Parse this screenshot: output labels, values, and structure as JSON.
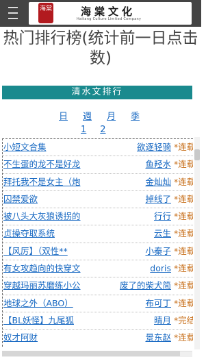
{
  "header": {
    "menu_icon": "hamburger-icon",
    "logo_seal_text": "海棠",
    "logo_name": "海棠文化",
    "logo_sub": "Haitang Culture Limited Company"
  },
  "page_title": "热门排行榜(统计前一日点击数)",
  "section_title": "清水文排行",
  "periods": [
    "日",
    "週",
    "月",
    "季"
  ],
  "pages": [
    "1",
    "2"
  ],
  "colors": {
    "section_bg": "#1a8a8e",
    "link": "#1768c2",
    "status": "#c8711d"
  },
  "rankings": [
    {
      "title": "小短文合集",
      "author": "欲逐轻骑",
      "status": "*连载"
    },
    {
      "title": "不生蛋的龙不是好龙",
      "author": "鱼羟水",
      "status": "*连载"
    },
    {
      "title": "拜托我不是女主（炮",
      "author": "金灿灿",
      "status": "*连载"
    },
    {
      "title": "囚禁爱欲",
      "author": "掉线了",
      "status": "*连载"
    },
    {
      "title": "被八头大灰狼诱拐的",
      "author": "行行",
      "status": "*连载"
    },
    {
      "title": "贞操夺取系统",
      "author": "云生",
      "status": "*连载"
    },
    {
      "title": "【风厉】（双性**",
      "author": "小秦子",
      "status": "*连载"
    },
    {
      "title": "有女攻趋向的快穿文",
      "author": "doris",
      "status": "*连载"
    },
    {
      "title": "穿越玛丽苏磨练小公",
      "author": "废了的柴犬简",
      "status": "*连载"
    },
    {
      "title": "地球之外（ABO）",
      "author": "布可丁",
      "status": "*连载"
    },
    {
      "title": "【BL妖怪】九尾狐",
      "author": "晴月",
      "status": "*完结"
    },
    {
      "title": "奴才阿财",
      "author": "景东赵",
      "status": "*连载"
    }
  ]
}
